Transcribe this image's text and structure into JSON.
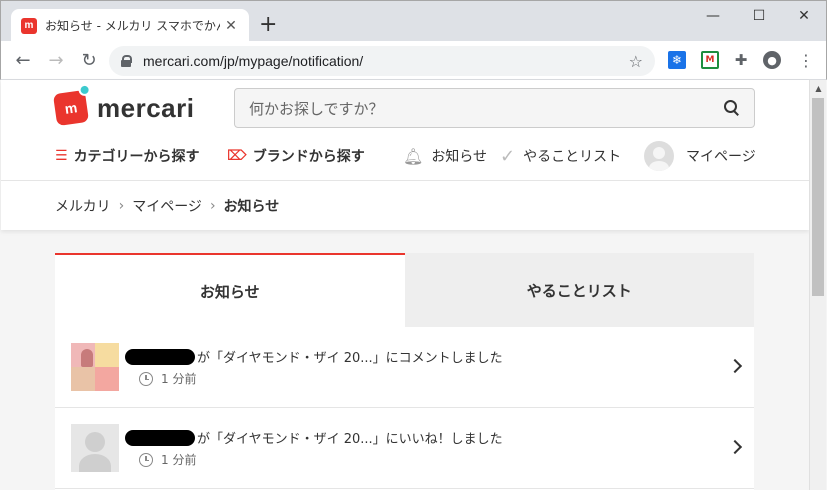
{
  "browser": {
    "tab_title": "お知らせ - メルカリ スマホでかんたん フ",
    "tab_close": "✕",
    "new_tab": "+",
    "url": "mercari.com/jp/mypage/notification/",
    "minimize": "—",
    "maximize": "☐",
    "close": "✕"
  },
  "header": {
    "logo_text": "mercari",
    "search_placeholder": "何かお探しですか？",
    "nav": {
      "category": "カテゴリーから探す",
      "brand": "ブランドから探す",
      "notifications": "お知らせ",
      "todo": "やることリスト",
      "mypage": "マイページ"
    }
  },
  "breadcrumb": [
    "メルカリ",
    "マイページ",
    "お知らせ"
  ],
  "tabs": {
    "notifications": "お知らせ",
    "todo": "やることリスト"
  },
  "notifications": [
    {
      "text": "が「ダイヤモンド・ザイ 20...」にコメントしました",
      "time": "1 分前"
    },
    {
      "text": "が「ダイヤモンド・ザイ 20...」にいいね！しました",
      "time": "1 分前"
    }
  ],
  "colors": {
    "brand": "#ea352d",
    "accent": "#3ccace"
  }
}
